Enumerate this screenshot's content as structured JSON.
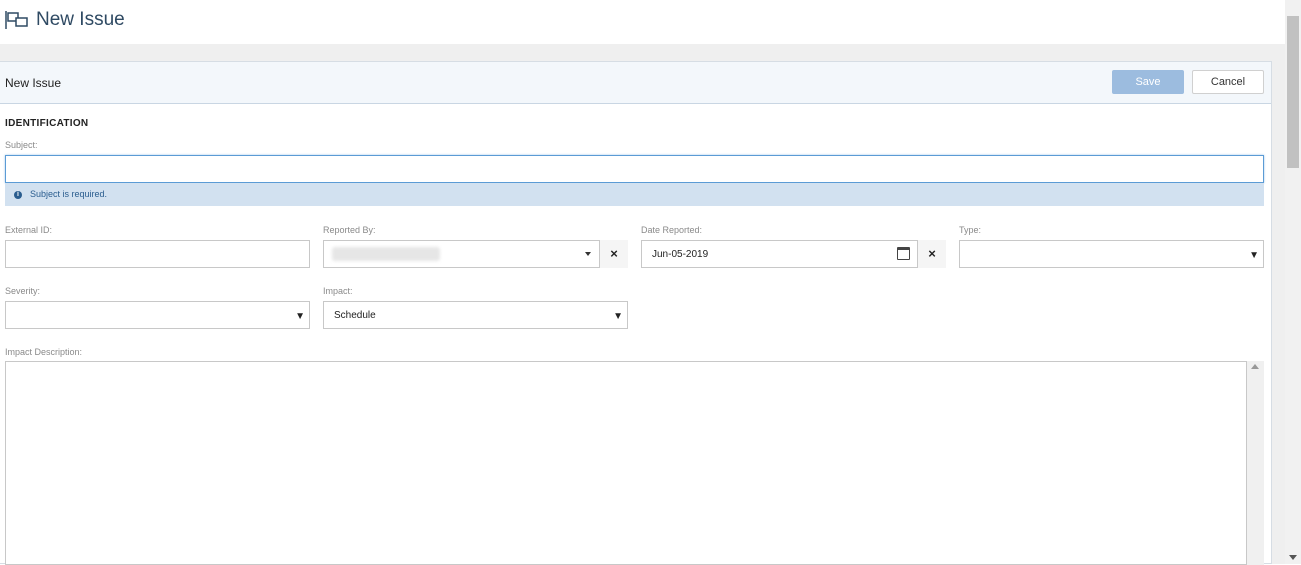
{
  "page": {
    "title": "New Issue",
    "icon": "issue-icon"
  },
  "panel": {
    "title": "New Issue",
    "save_label": "Save",
    "cancel_label": "Cancel",
    "save_color": "#9cbcdf"
  },
  "form": {
    "section_title": "IDENTIFICATION",
    "subject": {
      "label": "Subject:",
      "value": ""
    },
    "validation": {
      "icon": "info-icon",
      "message": "Subject is required."
    },
    "external_id": {
      "label": "External ID:",
      "value": ""
    },
    "reported_by": {
      "label": "Reported By:",
      "clear_label": "×"
    },
    "date_reported": {
      "label": "Date Reported:",
      "value": "Jun-05-2019",
      "icon": "calendar-icon",
      "clear_label": "×"
    },
    "type": {
      "label": "Type:",
      "value": ""
    },
    "severity": {
      "label": "Severity:",
      "value": ""
    },
    "impact": {
      "label": "Impact:",
      "value": "Schedule"
    },
    "impact_description": {
      "label": "Impact Description:",
      "value": ""
    }
  },
  "glyphs": {
    "dropdown": "▼"
  }
}
